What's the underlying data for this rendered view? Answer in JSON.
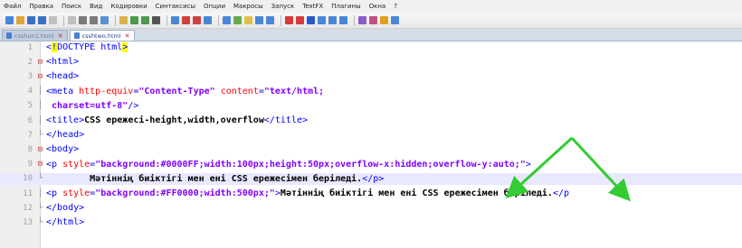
{
  "menu": [
    "Файл",
    "Правка",
    "Поиск",
    "Вид",
    "Кодировки",
    "Синтаксисы",
    "Опции",
    "Макросы",
    "Запуск",
    "TextFX",
    "Плагины",
    "Окна",
    "?"
  ],
  "toolbar": {
    "buttons": [
      "new-file",
      "open-file",
      "save-file",
      "save-all",
      "close-file",
      "close-all",
      "print",
      "cut",
      "copy",
      "paste",
      "undo",
      "redo",
      "find",
      "replace",
      "zoom-in",
      "zoom-out",
      "sync-v",
      "sync-h",
      "wrap",
      "show-all",
      "indent-guide",
      "fold-all",
      "unfold-all",
      "macro-record",
      "macro-stop",
      "macro-play",
      "macro-run",
      "macro-save",
      "spell",
      "plugin-1",
      "plugin-2",
      "plugin-3"
    ]
  },
  "tabs": [
    {
      "label": "csshun1.html",
      "active": false
    },
    {
      "label": "csshtwo.html",
      "active": true
    }
  ],
  "lines": [
    {
      "n": "1",
      "fold": "",
      "tokens": [
        [
          "tag",
          "<"
        ],
        [
          "hl",
          "!"
        ],
        [
          "tag",
          "DOCTYPE html"
        ],
        [
          "hl",
          ">"
        ]
      ]
    },
    {
      "n": "2",
      "fold": "open",
      "tokens": [
        [
          "tag",
          "<html>"
        ]
      ]
    },
    {
      "n": "3",
      "fold": "open",
      "tokens": [
        [
          "tag",
          "<head>"
        ]
      ]
    },
    {
      "n": "4",
      "fold": "bar",
      "tokens": [
        [
          "tag",
          "<meta "
        ],
        [
          "attr",
          "http-equiv"
        ],
        [
          "tag",
          "="
        ],
        [
          "val",
          "\"Content-Type\""
        ],
        [
          "tag",
          " "
        ],
        [
          "attr",
          "content"
        ],
        [
          "tag",
          "="
        ],
        [
          "val",
          "\"text/html;"
        ]
      ]
    },
    {
      "n": "5",
      "fold": "bar",
      "tokens": [
        [
          "val",
          " charset=utf-8\""
        ],
        [
          "tag",
          "/>"
        ]
      ]
    },
    {
      "n": "6",
      "fold": "bar",
      "tokens": [
        [
          "tag",
          "<title>"
        ],
        [
          "txt",
          "CSS ережесі-height,width,overflow"
        ],
        [
          "tag",
          "</title>"
        ]
      ]
    },
    {
      "n": "7",
      "fold": "end",
      "tokens": [
        [
          "tag",
          "</head>"
        ]
      ]
    },
    {
      "n": "8",
      "fold": "open",
      "tokens": [
        [
          "tag",
          "<body>"
        ]
      ]
    },
    {
      "n": "9",
      "fold": "open",
      "tokens": [
        [
          "tag",
          "<p "
        ],
        [
          "attr",
          "style"
        ],
        [
          "tag",
          "="
        ],
        [
          "val",
          "\"background:#0000FF;width:100px;height:50px;overflow-x:hidden;overflow-y:auto;\""
        ],
        [
          "tag",
          ">"
        ]
      ]
    },
    {
      "n": "10",
      "fold": "end",
      "current": true,
      "tokens": [
        [
          "txt",
          "        Мәтіннің биіктігі мен ені CSS ережесімен беріледі."
        ],
        [
          "tag",
          "</p>"
        ]
      ]
    },
    {
      "n": "11",
      "fold": "bar",
      "tokens": [
        [
          "tag",
          "<p "
        ],
        [
          "attr",
          "style"
        ],
        [
          "tag",
          "="
        ],
        [
          "val",
          "\"background:#FF0000;width:500px;\""
        ],
        [
          "tag",
          ">"
        ],
        [
          "txt",
          "Мәтіннің биіктігі мен ені CSS ережесімен беріледі."
        ],
        [
          "tag",
          "</p"
        ]
      ]
    },
    {
      "n": "12",
      "fold": "end",
      "tokens": [
        [
          "tag",
          "</body>"
        ]
      ]
    },
    {
      "n": "13",
      "fold": "end",
      "tokens": [
        [
          "tag",
          "</html>"
        ]
      ]
    }
  ],
  "annotation": {
    "arrow_color": "#33cc33"
  }
}
